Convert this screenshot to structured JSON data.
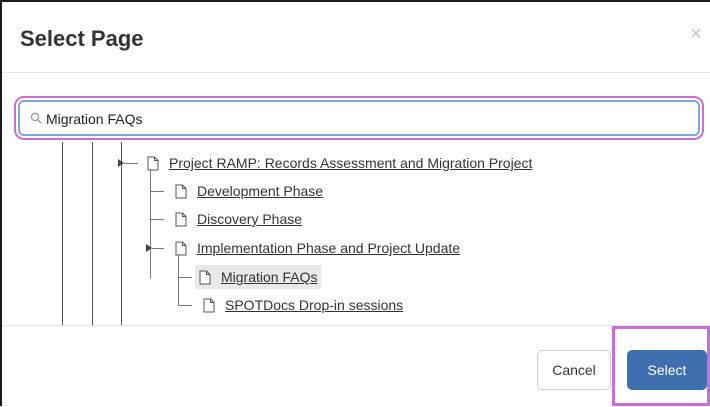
{
  "dialog": {
    "title": "Select Page",
    "close_symbol": "×"
  },
  "search": {
    "value": "Migration FAQs",
    "highlight_color": "#c86ed8"
  },
  "tree": {
    "items": [
      {
        "label": "Project RAMP: Records Assessment and Migration Project",
        "expanded": true,
        "icon": "page-icon"
      },
      {
        "label": "Development Phase",
        "icon": "page-icon"
      },
      {
        "label": "Discovery Phase",
        "icon": "page-icon"
      },
      {
        "label": "Implementation Phase and Project Update",
        "expanded": true,
        "icon": "page-icon"
      },
      {
        "label": "Migration FAQs",
        "selected": true,
        "icon": "page-icon"
      },
      {
        "label": "SPOTDocs Drop-in sessions",
        "icon": "page-icon"
      }
    ]
  },
  "footer": {
    "cancel_label": "Cancel",
    "select_label": "Select",
    "select_color": "#3f6faf"
  }
}
